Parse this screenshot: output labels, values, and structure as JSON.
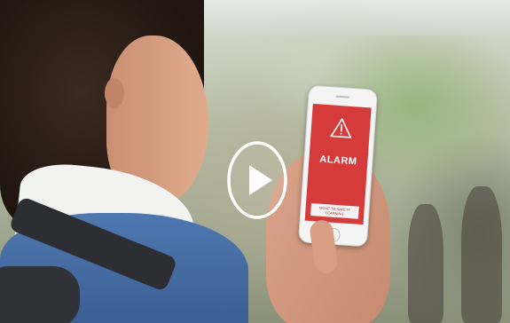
{
  "video": {
    "play_button": "play-icon"
  },
  "phone_screen": {
    "icon": "warning-triangle-icon",
    "title": "ALARM",
    "button_label": "MOVE TO SAFETY LEARNING"
  },
  "colors": {
    "alarm_red": "#d63b3b",
    "play_white": "#ffffff"
  }
}
